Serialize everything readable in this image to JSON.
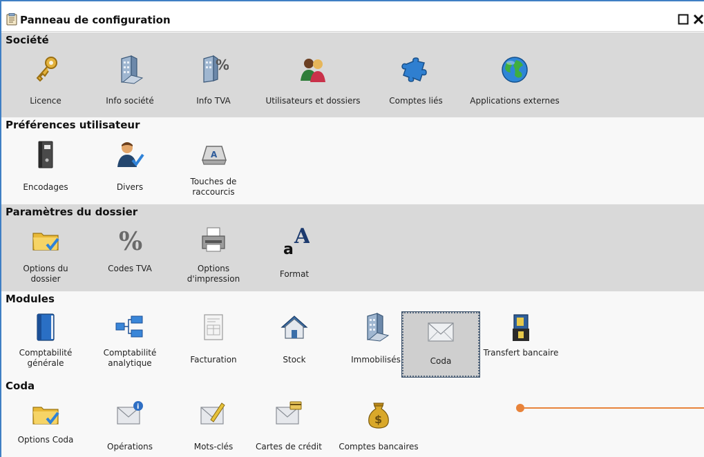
{
  "window": {
    "title": "Panneau de configuration"
  },
  "sections": [
    {
      "name": "Société",
      "items": [
        {
          "label": "Licence",
          "icon": "key-icon"
        },
        {
          "label": "Info société",
          "icon": "building-icon"
        },
        {
          "label": "Info TVA",
          "icon": "building-percent-icon"
        },
        {
          "label": "Utilisateurs et dossiers",
          "icon": "users-icon"
        },
        {
          "label": "Comptes liés",
          "icon": "puzzle-icon"
        },
        {
          "label": "Applications externes",
          "icon": "globe-icon"
        }
      ]
    },
    {
      "name": "Préférences utilisateur",
      "items": [
        {
          "label": "Encodages",
          "icon": "binder-icon"
        },
        {
          "label": "Divers",
          "icon": "user-check-icon"
        },
        {
          "label": "Touches de raccourcis",
          "icon": "keyboard-key-icon"
        }
      ]
    },
    {
      "name": "Paramètres du dossier",
      "items": [
        {
          "label": "Options du dossier",
          "icon": "folder-check-icon"
        },
        {
          "label": "Codes TVA",
          "icon": "percent-icon"
        },
        {
          "label": "Options d'impression",
          "icon": "printer-icon"
        },
        {
          "label": "Format",
          "icon": "font-format-icon"
        }
      ]
    },
    {
      "name": "Modules",
      "items": [
        {
          "label": "Comptabilité générale",
          "icon": "ledger-book-icon"
        },
        {
          "label": "Comptabilité analytique",
          "icon": "org-chart-icon"
        },
        {
          "label": "Facturation",
          "icon": "invoice-icon"
        },
        {
          "label": "Stock",
          "icon": "house-icon"
        },
        {
          "label": "Immobilisés",
          "icon": "building-icon"
        },
        {
          "label": "Coda",
          "icon": "envelope-icon"
        },
        {
          "label": "Transfert bancaire",
          "icon": "bank-transfer-icon"
        }
      ]
    },
    {
      "name": "Coda",
      "items": [
        {
          "label": "Options Coda",
          "icon": "folder-check-icon"
        },
        {
          "label": "Opérations",
          "icon": "envelope-info-icon"
        },
        {
          "label": "Mots-clés",
          "icon": "envelope-pencil-icon"
        },
        {
          "label": "Cartes de crédit",
          "icon": "envelope-card-icon"
        },
        {
          "label": "Comptes bancaires",
          "icon": "money-bag-icon"
        }
      ]
    }
  ],
  "selected_item": "Coda",
  "colors": {
    "accent_border": "#3f7fc4",
    "callout": "#e8833a",
    "section_gray": "#d9d9d9"
  }
}
